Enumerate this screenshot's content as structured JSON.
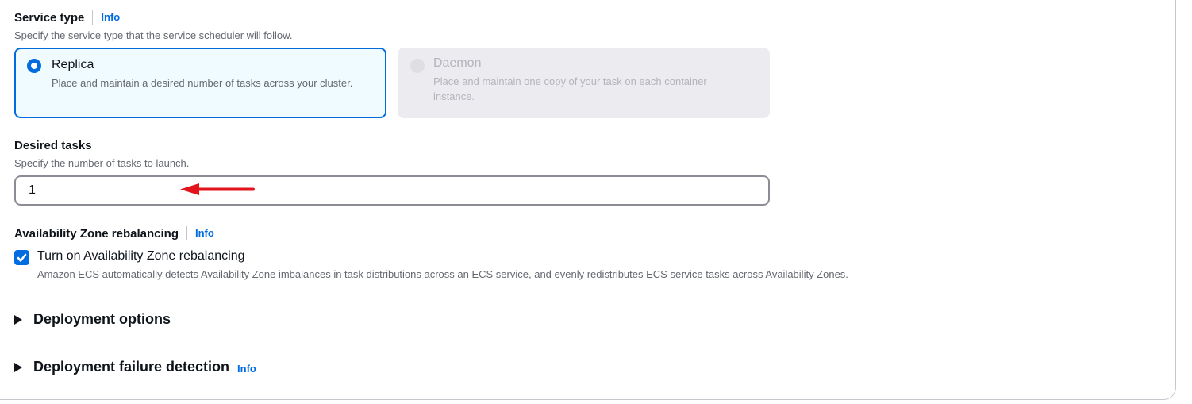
{
  "service_type": {
    "label": "Service type",
    "info": "Info",
    "description": "Specify the service type that the service scheduler will follow.",
    "options": [
      {
        "title": "Replica",
        "description": "Place and maintain a desired number of tasks across your cluster.",
        "selected": true,
        "disabled": false
      },
      {
        "title": "Daemon",
        "description": "Place and maintain one copy of your task on each container instance.",
        "selected": false,
        "disabled": true
      }
    ]
  },
  "desired_tasks": {
    "label": "Desired tasks",
    "description": "Specify the number of tasks to launch.",
    "value": "1"
  },
  "az_rebalancing": {
    "label": "Availability Zone rebalancing",
    "info": "Info",
    "checkbox_label": "Turn on Availability Zone rebalancing",
    "checked": true,
    "checkbox_description": "Amazon ECS automatically detects Availability Zone imbalances in task distributions across an ECS service, and evenly redistributes ECS service tasks across Availability Zones."
  },
  "sections": [
    {
      "label": "Deployment options"
    },
    {
      "label": "Deployment failure detection",
      "info": "Info"
    }
  ],
  "annotation": {
    "arrow_color": "#e3151c"
  }
}
